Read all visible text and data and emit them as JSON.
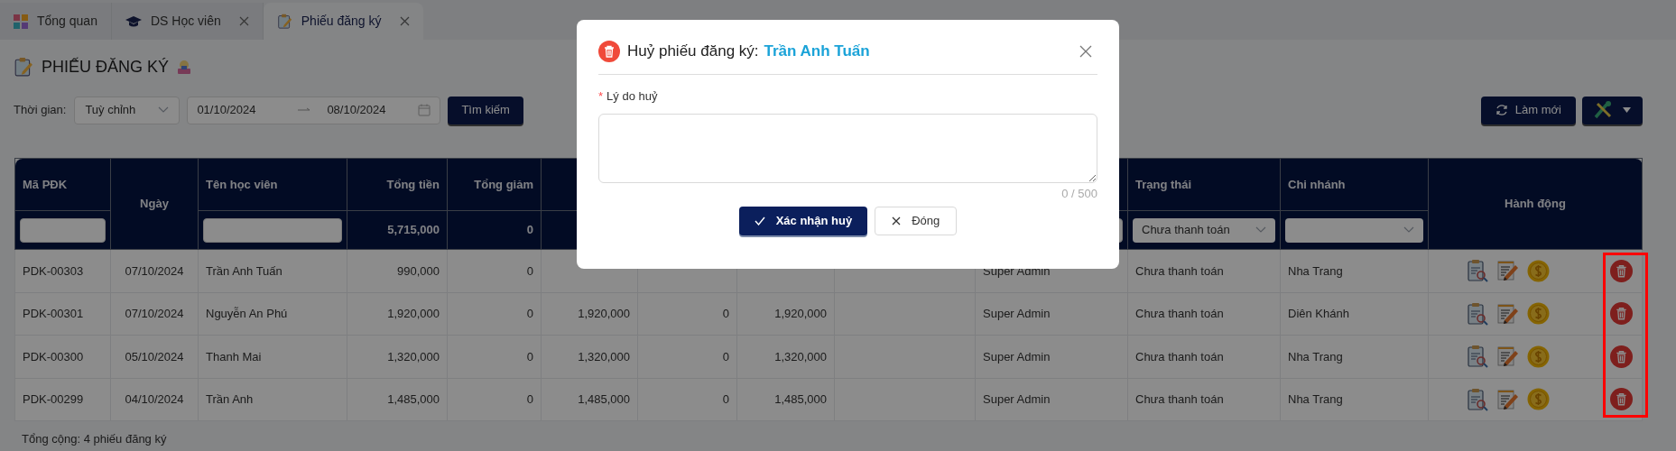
{
  "tabs": [
    {
      "label": "Tổng quan",
      "selected": false,
      "closable": false,
      "kind": "grid"
    },
    {
      "label": "DS Học viên",
      "selected": false,
      "closable": true,
      "kind": "cap"
    },
    {
      "label": "Phiếu đăng ký",
      "selected": true,
      "closable": true,
      "kind": "clipboard"
    }
  ],
  "page_title": "PHIẾU ĐĂNG KÝ",
  "filter": {
    "label": "Thời gian:",
    "period": "Tuỳ chỉnh",
    "date_from": "01/10/2024",
    "date_to": "08/10/2024",
    "search_button": "Tìm kiếm"
  },
  "toolbar": {
    "refresh_button": "Làm mới"
  },
  "table": {
    "columns": [
      {
        "label": "Mã PĐK",
        "merged": false
      },
      {
        "label": "Ngày",
        "merged": true
      },
      {
        "label": "Tên học viên",
        "merged": false
      },
      {
        "label": "Tổng tiền",
        "merged": false
      },
      {
        "label": "Tổng giảm",
        "merged": false
      },
      {
        "label": "Trạng thái",
        "merged": false
      },
      {
        "label": "Chi nhánh",
        "merged": false
      },
      {
        "label": "Hành động",
        "merged": true
      }
    ],
    "filters": [
      {
        "kind": "input"
      },
      {
        "kind": "input"
      },
      {
        "kind": "total",
        "text": "5,715,000"
      },
      {
        "kind": "total",
        "text": "0"
      },
      {
        "kind": "blank"
      },
      {
        "kind": "blank"
      },
      {
        "kind": "blank"
      },
      {
        "kind": "blank"
      },
      {
        "kind": "input"
      },
      {
        "kind": "select",
        "value": "Chưa thanh toán"
      },
      {
        "kind": "select"
      }
    ],
    "rows": [
      {
        "ma_pdk": "PDK-00303",
        "ngay": "07/10/2024",
        "ten_hoc_vien": "Trần Anh Tuấn",
        "tong_tien": "990,000",
        "tong_giam": "0",
        "column_10": "Super Admin",
        "trang_thai": "Chưa thanh toán",
        "chi_nhanh": "Nha Trang"
      },
      {
        "ma_pdk": "PDK-00301",
        "ngay": "07/10/2024",
        "ten_hoc_vien": "Nguyễn An Phú",
        "tong_tien": "1,920,000",
        "tong_giam": "0",
        "column_6": "1,920,000",
        "column_7": "0",
        "column_8": "1,920,000",
        "column_10": "Super Admin",
        "trang_thai": "Chưa thanh toán",
        "chi_nhanh": "Diên Khánh"
      },
      {
        "ma_pdk": "PDK-00300",
        "ngay": "05/10/2024",
        "ten_hoc_vien": "Thanh Mai",
        "tong_tien": "1,320,000",
        "tong_giam": "0",
        "column_6": "1,320,000",
        "column_7": "0",
        "column_8": "1,320,000",
        "column_10": "Super Admin",
        "trang_thai": "Chưa thanh toán",
        "chi_nhanh": "Nha Trang"
      },
      {
        "ma_pdk": "PDK-00299",
        "ngay": "04/10/2024",
        "ten_hoc_vien": "Trần Anh",
        "tong_tien": "1,485,000",
        "tong_giam": "0",
        "column_6": "1,485,000",
        "column_7": "0",
        "column_8": "1,485,000",
        "column_10": "Super Admin",
        "trang_thai": "Chưa thanh toán",
        "chi_nhanh": "Nha Trang"
      }
    ],
    "footer": "Tổng cộng: 4 phiếu đăng ký",
    "highlight_delete_column": true
  },
  "modal": {
    "title": "Huỷ phiếu đăng ký:",
    "name": "Trần Anh Tuấn",
    "field_label": "Lý do huỷ",
    "required_mark": "*",
    "counter": "0 / 500",
    "confirm_button": "Xác nhận huỷ",
    "close_button": "Đóng"
  }
}
